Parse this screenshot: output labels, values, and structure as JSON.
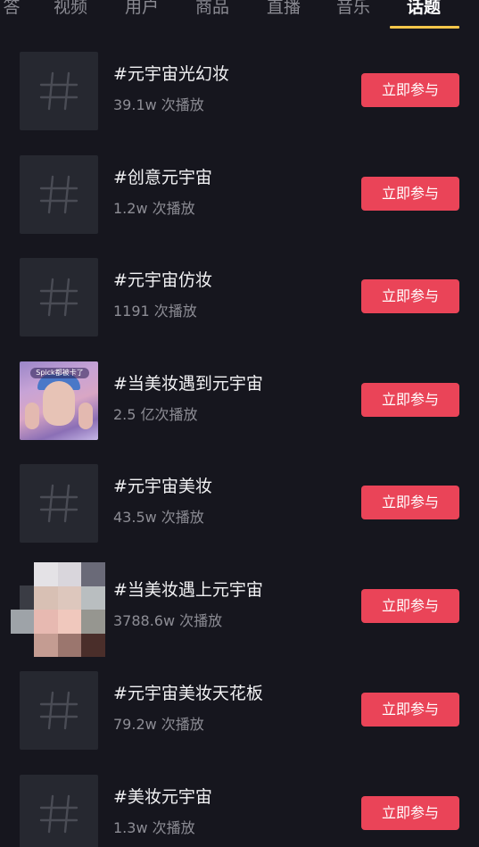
{
  "tabs": [
    {
      "label": "答"
    },
    {
      "label": "视频"
    },
    {
      "label": "用户"
    },
    {
      "label": "商品"
    },
    {
      "label": "直播"
    },
    {
      "label": "音乐"
    },
    {
      "label": "话题",
      "active": true
    }
  ],
  "join_label": "立即参与",
  "colors": {
    "background": "#16161e",
    "accent_button": "#ea4458",
    "tab_underline": "#f4c64a",
    "thumbnail_bg": "#262830"
  },
  "photo_thumb_caption": "Spick都被卡了",
  "topics": [
    {
      "title": "#元宇宙光幻妆",
      "plays": "39.1w 次播放",
      "thumbnail": "hash-icon"
    },
    {
      "title": "#创意元宇宙",
      "plays": "1.2w 次播放",
      "thumbnail": "hash-icon"
    },
    {
      "title": "#元宇宙仿妆",
      "plays": "1191 次播放",
      "thumbnail": "hash-icon"
    },
    {
      "title": "#当美妆遇到元宇宙",
      "plays": "2.5 亿次播放",
      "thumbnail": "makeup-photo"
    },
    {
      "title": "#元宇宙美妆",
      "plays": "43.5w 次播放",
      "thumbnail": "hash-icon"
    },
    {
      "title": "#当美妆遇上元宇宙",
      "plays": "3788.6w 次播放",
      "thumbnail": "pixelated-photo"
    },
    {
      "title": "#元宇宙美妆天花板",
      "plays": "79.2w 次播放",
      "thumbnail": "hash-icon"
    },
    {
      "title": "#美妆元宇宙",
      "plays": "1.3w 次播放",
      "thumbnail": "hash-icon"
    }
  ]
}
